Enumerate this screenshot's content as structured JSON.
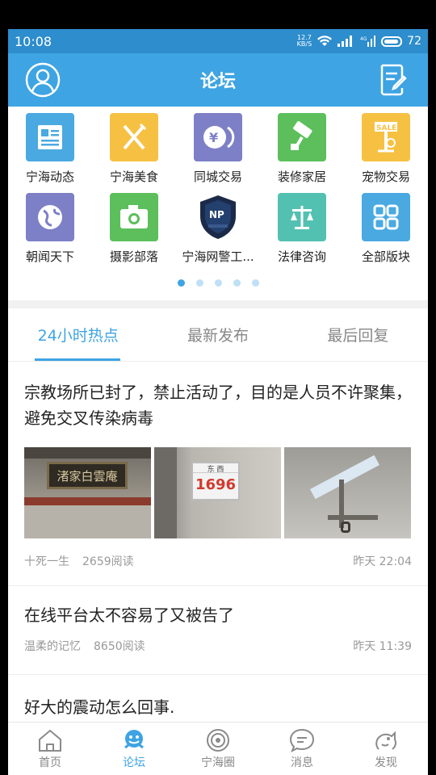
{
  "status": {
    "time": "10:08",
    "net_speed_value": "12.7",
    "net_speed_unit": "KB/S",
    "battery": "72"
  },
  "header": {
    "title": "论坛"
  },
  "categories": [
    {
      "label": "宁海动态",
      "color": "#4aa9e0",
      "icon": "news-icon"
    },
    {
      "label": "宁海美食",
      "color": "#f6c143",
      "icon": "fork-knife-icon"
    },
    {
      "label": "同城交易",
      "color": "#7d80c6",
      "icon": "yuan-coin-icon"
    },
    {
      "label": "装修家居",
      "color": "#5cbf5c",
      "icon": "paint-roller-icon"
    },
    {
      "label": "宠物交易",
      "color": "#f6c143",
      "icon": "sale-sign-icon"
    },
    {
      "label": "朝闻天下",
      "color": "#7d80c6",
      "icon": "globe-icon"
    },
    {
      "label": "摄影部落",
      "color": "#5cbf5c",
      "icon": "camera-icon"
    },
    {
      "label": "宁海网警工...",
      "color": "#1c2a4a",
      "icon": "police-badge-icon"
    },
    {
      "label": "法律咨询",
      "color": "#53c1b1",
      "icon": "scales-icon"
    },
    {
      "label": "全部版块",
      "color": "#4aa9e0",
      "icon": "grid-icon"
    }
  ],
  "tabs": [
    {
      "label": "24小时热点",
      "active": true
    },
    {
      "label": "最新发布",
      "active": false
    },
    {
      "label": "最后回复",
      "active": false
    }
  ],
  "posts": [
    {
      "title": "宗教场所已封了，禁止活动了，目的是人员不许聚集，避免交叉传染病毒",
      "author": "十死一生",
      "reads": "2659阅读",
      "time": "昨天 22:04",
      "sign_text": "渚家白雲庵",
      "plate_label": "东 西",
      "plate_number": "1696"
    },
    {
      "title": "在线平台太不容易了又被告了",
      "author": "温柔的记忆",
      "reads": "8650阅读",
      "time": "昨天 11:39"
    },
    {
      "title": "好大的震动怎么回事."
    }
  ],
  "nav": [
    {
      "label": "首页",
      "icon": "home-icon"
    },
    {
      "label": "论坛",
      "icon": "forum-icon"
    },
    {
      "label": "宁海圈",
      "icon": "circle-icon"
    },
    {
      "label": "消息",
      "icon": "message-icon"
    },
    {
      "label": "发现",
      "icon": "discover-icon"
    }
  ],
  "colors": {
    "brand": "#3ea4e3",
    "statusbar": "#2d8dcd"
  }
}
